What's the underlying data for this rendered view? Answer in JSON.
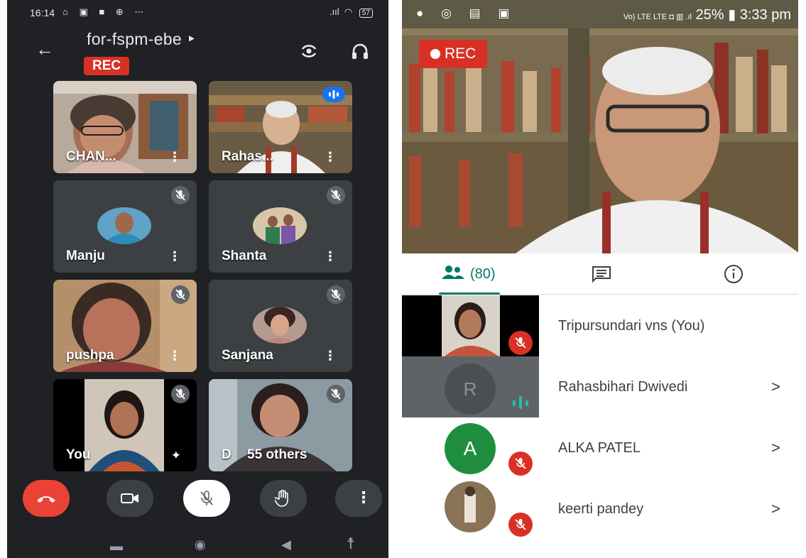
{
  "left": {
    "status": {
      "time": "16:14",
      "icons": "⌂ ▣ ■ ⊕ ⋯",
      "signal": ".ııl",
      "battery": "57"
    },
    "meeting": {
      "title": "for-fspm-ebe ‣",
      "rec_label": "REC"
    },
    "tiles": [
      {
        "name": "CHAN..."
      },
      {
        "name": "Rahas..."
      },
      {
        "name": "Manju"
      },
      {
        "name": "Shanta"
      },
      {
        "name": "pushpa"
      },
      {
        "name": "Sanjana"
      },
      {
        "name": "You"
      },
      {
        "name": "D",
        "overlay": "55 others"
      }
    ],
    "colors": {
      "background": "#202124",
      "tile": "#3c4043",
      "end_call": "#ea4335",
      "accent_blue": "#1a73e8"
    }
  },
  "right": {
    "status": {
      "icons": "● ◎ ▤ ▣",
      "network": "Vo) LTE  LTE ◘ ▥ .ıl",
      "battery": "25%",
      "time": "3:33 pm"
    },
    "rec_label": "REC",
    "tabs": {
      "people_count": "(80)"
    },
    "participants": [
      {
        "name": "Tripursundari vns (You)"
      },
      {
        "name": "Rahasbihari Dwivedi",
        "avatar_letter": "R"
      },
      {
        "name": "ALKA PATEL",
        "avatar_letter": "A"
      },
      {
        "name": "keerti pandey"
      }
    ],
    "colors": {
      "teal": "#00796b",
      "mute_red": "#d93025",
      "avatar_green": "#1e8e3e"
    }
  }
}
